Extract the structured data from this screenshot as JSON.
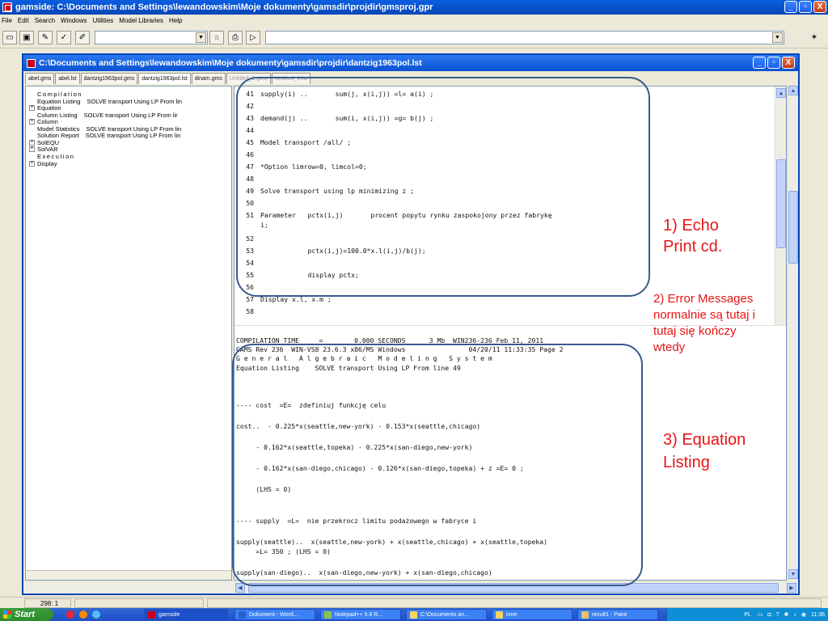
{
  "window": {
    "title": "gamside: C:\\Documents and Settings\\lewandowskim\\Moje dokumenty\\gamsdir\\projdir\\gmsproj.gpr",
    "minimize": "_",
    "maximize": "▫",
    "close": "X"
  },
  "menu": [
    "File",
    "Edit",
    "Search",
    "Windows",
    "Utilities",
    "Model Libraries",
    "Help"
  ],
  "toolbar": {
    "combo_value": "",
    "path_value": "",
    "button_a": "a"
  },
  "doc": {
    "title": "C:\\Documents and Settings\\lewandowskim\\Moje dokumenty\\gamsdir\\projdir\\dantzig1963pol.lst",
    "tabs": [
      {
        "label": "abel.gms",
        "state": "normal"
      },
      {
        "label": "abel.lst",
        "state": "normal"
      },
      {
        "label": "dantzig1963pol.gms",
        "state": "normal"
      },
      {
        "label": "dantzig1963pol.lst",
        "state": "active"
      },
      {
        "label": "dinam.gms",
        "state": "normal"
      },
      {
        "label": "Untitled_1.gms",
        "state": "faded"
      },
      {
        "label": "Untitled_1.lst",
        "state": "faded"
      }
    ]
  },
  "tree": [
    {
      "label": "Compilation",
      "detail": "",
      "expander": "",
      "spaced": true
    },
    {
      "label": "Equation Listing",
      "detail": "SOLVE transport Using LP From lin",
      "expander": "",
      "spaced": false
    },
    {
      "label": "Equation",
      "detail": "",
      "expander": "+",
      "spaced": false
    },
    {
      "label": "Column Listing",
      "detail": "SOLVE transport Using LP From lir",
      "expander": "",
      "spaced": false
    },
    {
      "label": "Column",
      "detail": "",
      "expander": "+",
      "spaced": false
    },
    {
      "label": "Model Statistics",
      "detail": "SOLVE transport Using LP From lin",
      "expander": "",
      "spaced": false
    },
    {
      "label": "Solution Report",
      "detail": "SOLVE transport Using LP From lin",
      "expander": "",
      "spaced": false
    },
    {
      "label": "SolEQU",
      "detail": "",
      "expander": "+",
      "spaced": false
    },
    {
      "label": "SolVAR",
      "detail": "",
      "expander": "+",
      "spaced": false
    },
    {
      "label": "Execution",
      "detail": "",
      "expander": "",
      "spaced": true
    },
    {
      "label": "Display",
      "detail": "",
      "expander": "+",
      "spaced": false
    }
  ],
  "code_lines": [
    {
      "num": "41",
      "text": "supply(i) ..       sum(j, x(i,j)) =l= a(i) ;"
    },
    {
      "num": "42",
      "text": ""
    },
    {
      "num": "43",
      "text": "demand(j) ..       sum(i, x(i,j)) =g= b(j) ;"
    },
    {
      "num": "44",
      "text": ""
    },
    {
      "num": "45",
      "text": "Model transport /all/ ;"
    },
    {
      "num": "46",
      "text": ""
    },
    {
      "num": "47",
      "text": "*Option limrow=0, limcol=0;"
    },
    {
      "num": "48",
      "text": ""
    },
    {
      "num": "49",
      "text": "Solve transport using lp minimizing z ;"
    },
    {
      "num": "50",
      "text": ""
    },
    {
      "num": "51",
      "text": "Parameter   pctx(i,j)       procent popytu rynku zaspokojony przez fabrykę"
    },
    {
      "num": "",
      "text": "i;"
    },
    {
      "num": "52",
      "text": ""
    },
    {
      "num": "53",
      "text": "            pctx(i,j)=100.0*x.l(i,j)/b(j);"
    },
    {
      "num": "54",
      "text": ""
    },
    {
      "num": "55",
      "text": "            display pctx;"
    },
    {
      "num": "56",
      "text": ""
    },
    {
      "num": "57",
      "text": "Display x.l, x.m ;"
    },
    {
      "num": "58",
      "text": ""
    }
  ],
  "listing_lines": [
    "COMPILATION TIME     =        0.000 SECONDS      3 Mb  WIN236-236 Feb 11, 2011",
    "\fGAMS Rev 236  WIN-VS8 23.6.3 x86/MS Windows                04/20/11 11:33:35 Page 2",
    "G e n e r a l   A l g e b r a i c   M o d e l i n g   S y s t e m",
    "Equation Listing    SOLVE transport Using LP From line 49",
    "",
    "",
    "---- cost  =E=  zdefiniuj funkcję celu",
    "",
    "cost..  - 0.225*x(seattle,new-york) - 0.153*x(seattle,chicago)",
    "",
    "     - 0.162*x(seattle,topeka) - 0.225*x(san-diego,new-york)",
    "",
    "     - 0.162*x(san-diego,chicago) - 0.126*x(san-diego,topeka) + z =E= 0 ;",
    "",
    "     (LHS = 0)",
    "",
    "",
    "---- supply  =L=  nie przekrocz limitu podażowego w fabryce i",
    "",
    "supply(seattle)..  x(seattle,new-york) + x(seattle,chicago) + x(seattle,topeka)",
    "     =L= 350 ; (LHS = 0)",
    "",
    "supply(san-diego)..  x(san-diego,new-york) + x(san-diego,chicago)"
  ],
  "annotations": {
    "a1_line1": "1) Echo",
    "a1_line2": "Print cd.",
    "a2_line1": "2) Error Messages",
    "a2_line2": "normalnie są tutaj i",
    "a2_line3": "tutaj się kończy",
    "a2_line4": "wtedy",
    "a3_line1": "3) Equation",
    "a3_line2": "Listing",
    "color": "#e81414"
  },
  "status": {
    "position": "298: 1"
  },
  "taskbar": {
    "start": "Start",
    "tasks": [
      "gamside",
      "Dokument - Word...",
      "Notepad++ 5.9 R...",
      "C:\\Documents an...",
      "inne",
      "rezult1 - Paint"
    ],
    "tray_lang": "PL",
    "clock": "11:36"
  }
}
